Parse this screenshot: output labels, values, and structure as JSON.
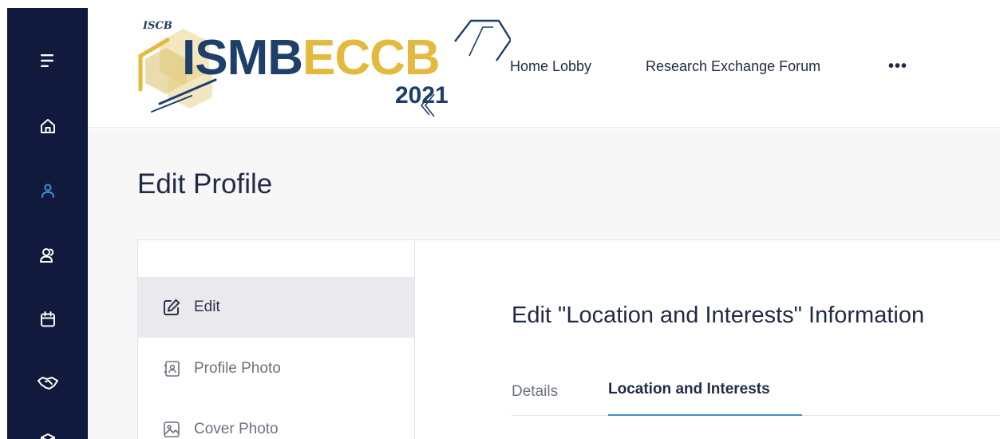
{
  "colors": {
    "sidebar_bg": "#111a3c",
    "accent_blue": "#3d8fd1",
    "logo_blue": "#1e3f6a",
    "logo_gold": "#e3b93e"
  },
  "sidebar": {
    "items": [
      {
        "icon": "menu-icon"
      },
      {
        "icon": "home-icon"
      },
      {
        "icon": "user-icon",
        "active": true
      },
      {
        "icon": "users-icon"
      },
      {
        "icon": "calendar-icon"
      },
      {
        "icon": "handshake-icon"
      },
      {
        "icon": "cube-icon"
      }
    ]
  },
  "header": {
    "logo": {
      "org": "ISCB",
      "name_part1": "ISMB",
      "name_part2": "ECCB",
      "year": "2021"
    },
    "nav": [
      {
        "label": "Home Lobby"
      },
      {
        "label": "Research Exchange Forum"
      }
    ],
    "more_label": "•••"
  },
  "page": {
    "title": "Edit Profile"
  },
  "left_menu": {
    "items": [
      {
        "label": "Edit",
        "icon": "edit-icon",
        "active": true
      },
      {
        "label": "Profile Photo",
        "icon": "profile-photo-icon"
      },
      {
        "label": "Cover Photo",
        "icon": "image-icon"
      }
    ]
  },
  "section": {
    "title": "Edit \"Location and Interests\" Information"
  },
  "tabs": [
    {
      "label": "Details"
    },
    {
      "label": "Location and Interests",
      "active": true
    }
  ]
}
